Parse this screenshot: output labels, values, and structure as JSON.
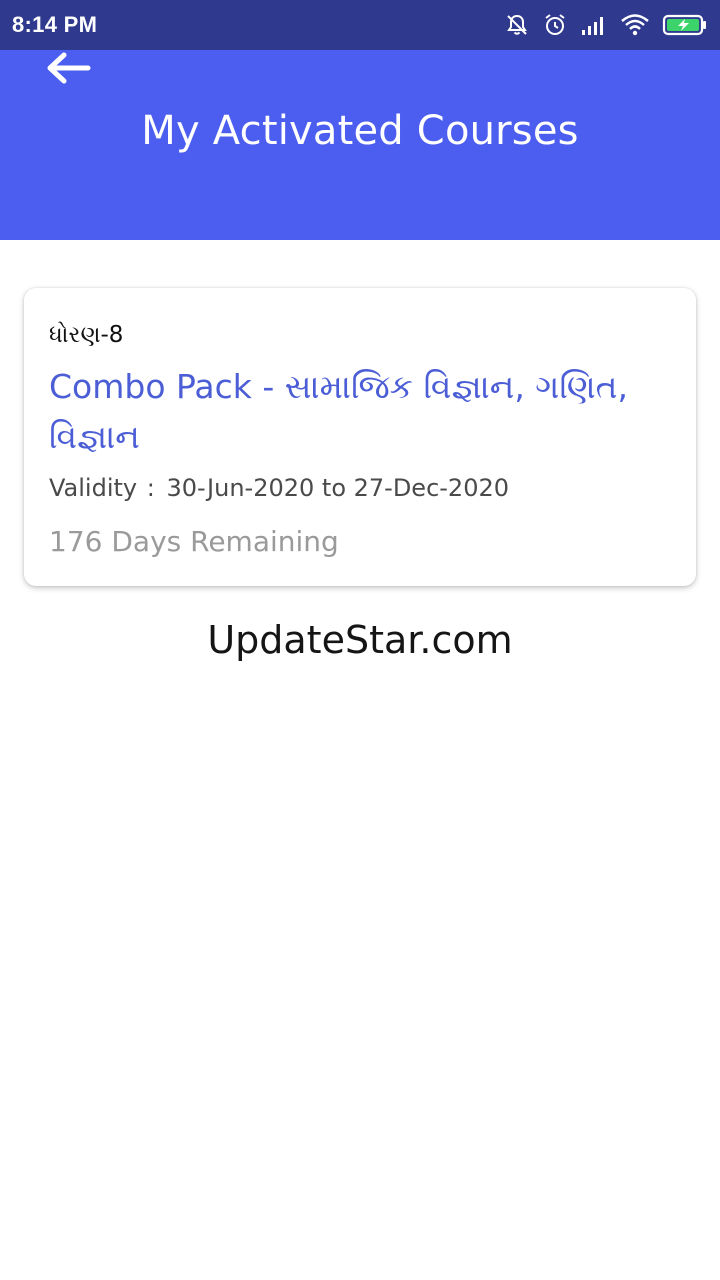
{
  "status_bar": {
    "time": "8:14 PM",
    "icons": [
      "muted-bell-icon",
      "alarm-icon",
      "signal-icon",
      "wifi-icon",
      "battery-charging-icon"
    ]
  },
  "header": {
    "back_icon": "arrow-left-icon",
    "title": "My Activated Courses",
    "color": "#4c5ef0"
  },
  "courses": [
    {
      "standard": "ધોરણ-8",
      "title": "Combo Pack - સામાજિક વિજ્ઞાન, ગણિત, વિજ્ઞાન",
      "validity_label": "Validity",
      "validity_sep": ":",
      "validity_range": "30-Jun-2020 to 27-Dec-2020",
      "remaining": "176 Days Remaining"
    }
  ],
  "watermark": "UpdateStar.com",
  "colors": {
    "status_bar": "#2f3a8f",
    "accent": "#4c5ed6",
    "muted_text": "#9a9a9a"
  }
}
